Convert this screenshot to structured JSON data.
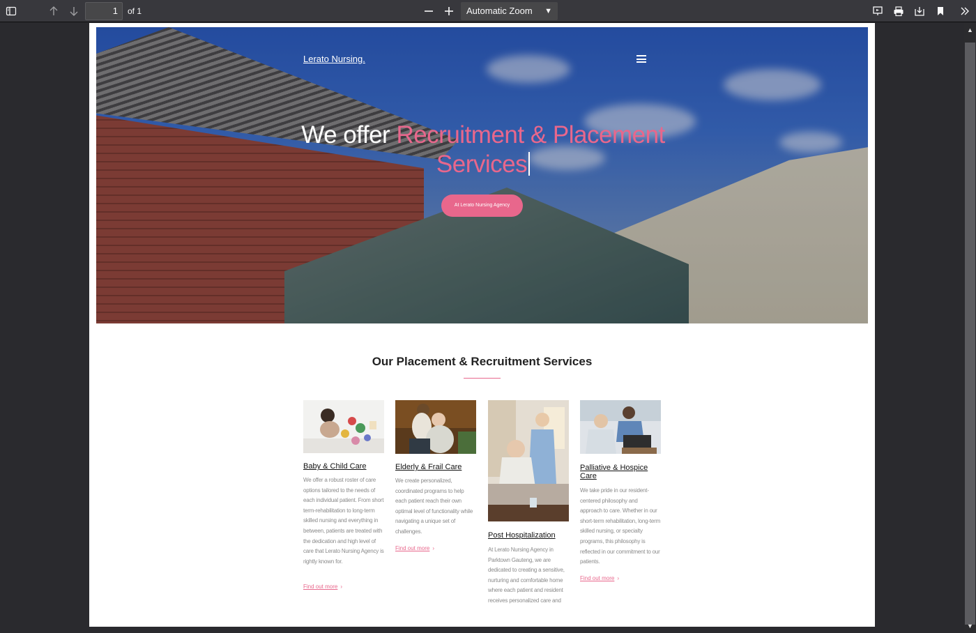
{
  "viewer": {
    "page_number": "1",
    "page_count": "of 1",
    "zoom_label": "Automatic Zoom"
  },
  "hero": {
    "brand": "Lerato Nursing.",
    "headline_plain": "We offer ",
    "headline_accent": "Recruitment & Placement Services",
    "cta_label": "At Lerato Nursing Agency"
  },
  "services": {
    "title": "Our Placement & Recruitment Services",
    "cards": [
      {
        "title": "Baby & Child Care",
        "text": "We offer a robust roster of care options tailored to the needs of each individual patient. From short term-rehabilitation to long-term skilled nursing and everything in between, patients are treated with the dedication and high level of care that Lerato Nursing Agency is rightly known for.",
        "link": "Find out more"
      },
      {
        "title": "Elderly & Frail Care",
        "text": "We create personalized, coordinated programs to help each patient reach their own optimal level of functionality while navigating a unique set of challenges.",
        "link": "Find out more"
      },
      {
        "title": "Post Hospitalization",
        "text": "At Lerato Nursing Agency in Parktown Gauteng, we are dedicated to creating a sensitive, nurturing and comfortable home where each patient and resident receives personalized care and",
        "link": ""
      },
      {
        "title": "Palliative & Hospice Care",
        "text": "We take pride in our resident-centered philosophy and approach to care. Whether in our short-term rehabilitation, long-term skilled nursing, or specialty programs, this philosophy is reflected in our commitment to our patients.",
        "link": "Find out more"
      }
    ]
  },
  "colors": {
    "accent": "#e8678c",
    "toolbar": "#38383d",
    "viewer_bg": "#2a2a2e"
  },
  "icons": [
    "sidebar-toggle-icon",
    "arrow-up-icon",
    "arrow-down-icon",
    "zoom-out-icon",
    "zoom-in-icon",
    "presentation-icon",
    "print-icon",
    "download-icon",
    "bookmark-icon",
    "tools-icon",
    "hamburger-menu-icon",
    "chevron-right-icon"
  ]
}
